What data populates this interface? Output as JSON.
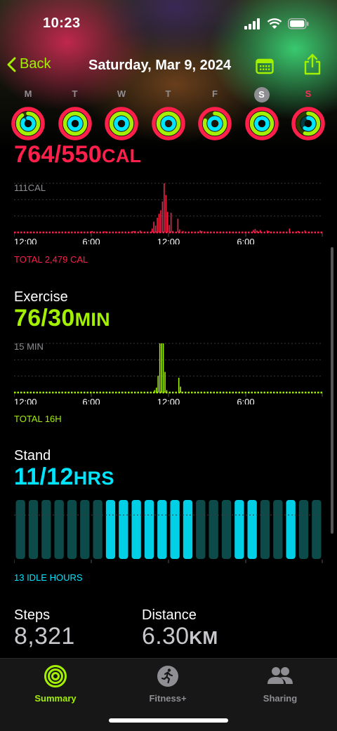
{
  "status_bar": {
    "time": "10:23"
  },
  "nav": {
    "back_label": "Back",
    "title": "Saturday, Mar 9, 2024"
  },
  "week": [
    {
      "letter": "M",
      "move": 1.0,
      "exercise": 0.9,
      "stand": 0.85
    },
    {
      "letter": "T",
      "move": 1.0,
      "exercise": 1.0,
      "stand": 1.0
    },
    {
      "letter": "W",
      "move": 1.0,
      "exercise": 1.0,
      "stand": 1.0
    },
    {
      "letter": "T",
      "move": 1.0,
      "exercise": 1.0,
      "stand": 1.0
    },
    {
      "letter": "F",
      "move": 1.0,
      "exercise": 0.8,
      "stand": 1.0
    },
    {
      "letter": "S",
      "move": 1.0,
      "exercise": 1.0,
      "stand": 0.92,
      "selected": true
    },
    {
      "letter": "S",
      "move": 1.0,
      "exercise": 0.55,
      "stand": 0.6
    }
  ],
  "move": {
    "value": "764/550",
    "unit": "CAL",
    "scale_label": "111CAL",
    "total": "TOTAL 2,479 CAL",
    "color": "#ff1f4b"
  },
  "exercise": {
    "title": "Exercise",
    "value": "76/30",
    "unit": "MIN",
    "scale_label": "15 MIN",
    "total": "TOTAL 16H",
    "color": "#a3f000"
  },
  "stand": {
    "title": "Stand",
    "value": "11/12",
    "unit": "HRS",
    "idle": "13 IDLE HOURS",
    "color": "#00e5ff"
  },
  "time_axis": [
    "12:00",
    "6:00",
    "12:00",
    "6:00"
  ],
  "chart_data": [
    {
      "type": "bar",
      "name": "move",
      "categories_per_hour": 4,
      "values": [
        0,
        0,
        0,
        0,
        0,
        0,
        0,
        0,
        0,
        0,
        0,
        0,
        0,
        0,
        0,
        0,
        0,
        0,
        0,
        0,
        0,
        0,
        0,
        0,
        0,
        0,
        0,
        0,
        0,
        0,
        0,
        0,
        0,
        0,
        0,
        0,
        0,
        0,
        0,
        0,
        0,
        0,
        0,
        0,
        2,
        3,
        0,
        0,
        0,
        0,
        0,
        0,
        2,
        2,
        0,
        0,
        0,
        0,
        0,
        0,
        0,
        0,
        0,
        0,
        0,
        0,
        0,
        0,
        2,
        3,
        3,
        0,
        0,
        4,
        0,
        0,
        0,
        0,
        0,
        0,
        8,
        22,
        14,
        30,
        38,
        45,
        63,
        100,
        76,
        42,
        15,
        40,
        3,
        0,
        0,
        28,
        6,
        0,
        3,
        0,
        0,
        0,
        0,
        0,
        0,
        0,
        0,
        0,
        4,
        3,
        0,
        0,
        0,
        0,
        0,
        0,
        0,
        0,
        0,
        0,
        0,
        0,
        0,
        0,
        0,
        2,
        0,
        0,
        0,
        0,
        0,
        0,
        0,
        0,
        0,
        0,
        0,
        0,
        0,
        5,
        7,
        4,
        0,
        5,
        0,
        0,
        0,
        4,
        3,
        0,
        0,
        0,
        0,
        0,
        0,
        0,
        0,
        0,
        0,
        0,
        8,
        0,
        0,
        0,
        0,
        3,
        0,
        0,
        0,
        4,
        0,
        0,
        0,
        0,
        0,
        0,
        0,
        0,
        0,
        0
      ]
    },
    {
      "type": "bar",
      "name": "exercise",
      "categories_per_hour": 4,
      "values": [
        0,
        0,
        0,
        0,
        0,
        0,
        0,
        0,
        0,
        0,
        0,
        0,
        0,
        0,
        0,
        0,
        0,
        0,
        0,
        0,
        0,
        0,
        0,
        0,
        0,
        0,
        0,
        0,
        0,
        0,
        0,
        0,
        0,
        0,
        0,
        0,
        0,
        0,
        0,
        0,
        0,
        0,
        0,
        0,
        0,
        0,
        0,
        0,
        0,
        0,
        0,
        0,
        0,
        0,
        0,
        0,
        0,
        0,
        0,
        0,
        0,
        0,
        0,
        0,
        0,
        0,
        0,
        0,
        0,
        0,
        0,
        0,
        0,
        0,
        0,
        0,
        0,
        0,
        0,
        0,
        0,
        5,
        10,
        34,
        100,
        100,
        100,
        42,
        5,
        0,
        0,
        0,
        0,
        0,
        0,
        30,
        12,
        0,
        0,
        0,
        0,
        0,
        0,
        0,
        0,
        0,
        0,
        0,
        0,
        0,
        0,
        0,
        0,
        0,
        0,
        0,
        0,
        0,
        0,
        0,
        0,
        0,
        0,
        0,
        0,
        0,
        0,
        0,
        0,
        0,
        0,
        0,
        0,
        0,
        0,
        0,
        0,
        0,
        0,
        0,
        0,
        0,
        0,
        0,
        0,
        0,
        0,
        0,
        0,
        0,
        0,
        0,
        0,
        0,
        0,
        0,
        0,
        0,
        0,
        0,
        0,
        0,
        0,
        0,
        0,
        0,
        0,
        0,
        0,
        0,
        0,
        0,
        0,
        0,
        0,
        0,
        0,
        0,
        0
      ]
    },
    {
      "type": "bar",
      "name": "stand",
      "hours": [
        0,
        0,
        0,
        0,
        0,
        0,
        0,
        1,
        1,
        1,
        1,
        1,
        1,
        1,
        0,
        0,
        0,
        1,
        1,
        0,
        0,
        1,
        0,
        0
      ]
    }
  ],
  "stats": {
    "steps_label": "Steps",
    "steps_value": "8,321",
    "distance_label": "Distance",
    "distance_value": "6.30",
    "distance_unit": "KM"
  },
  "tabs": [
    {
      "label": "Summary",
      "active": true
    },
    {
      "label": "Fitness+"
    },
    {
      "label": "Sharing"
    }
  ]
}
